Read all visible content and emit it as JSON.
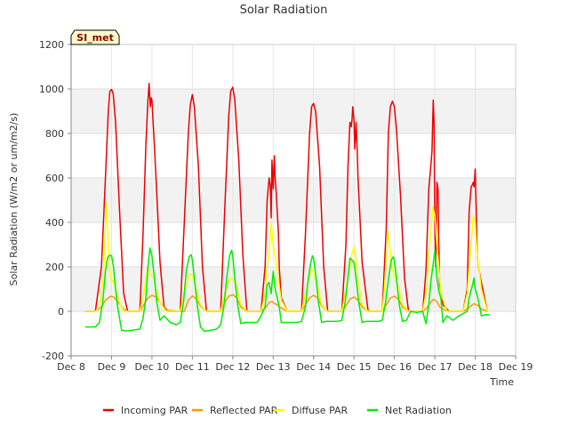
{
  "chart_data": {
    "type": "line",
    "title": "Solar Radiation",
    "xlabel": "Time",
    "ylabel": "Solar Radiation (W/m2 or um/m2/s)",
    "badge": "SI_met",
    "xlim": [
      8.0,
      19.0
    ],
    "ylim": [
      -200,
      1200
    ],
    "x_ticks": [
      8,
      9,
      10,
      11,
      12,
      13,
      14,
      15,
      16,
      17,
      18,
      19
    ],
    "x_tick_labels": [
      "Dec 8",
      "Dec 9",
      "Dec 10",
      "Dec 11",
      "Dec 12",
      "Dec 13",
      "Dec 14",
      "Dec 15",
      "Dec 16",
      "Dec 17",
      "Dec 18",
      "Dec 19"
    ],
    "y_ticks": [
      -200,
      0,
      200,
      400,
      600,
      800,
      1000,
      1200
    ],
    "y_tick_labels": [
      "-200",
      "0",
      "200",
      "400",
      "600",
      "800",
      "1000",
      "1200"
    ],
    "grid": true,
    "legend_position": "bottom",
    "series": [
      {
        "name": "Incoming PAR",
        "color": "#ee0000",
        "x": [
          8.35,
          8.6,
          8.75,
          8.85,
          8.92,
          8.96,
          9.0,
          9.04,
          9.1,
          9.2,
          9.3,
          9.4,
          9.7,
          9.78,
          9.85,
          9.9,
          9.93,
          9.96,
          9.98,
          10.0,
          10.02,
          10.05,
          10.1,
          10.2,
          10.3,
          10.4,
          10.7,
          10.8,
          10.9,
          10.95,
          11.0,
          11.05,
          11.15,
          11.25,
          11.35,
          11.7,
          11.8,
          11.9,
          11.95,
          12.0,
          12.05,
          12.15,
          12.25,
          12.35,
          12.7,
          12.8,
          12.85,
          12.9,
          12.93,
          12.95,
          12.97,
          13.0,
          13.03,
          13.05,
          13.08,
          13.1,
          13.13,
          13.15,
          13.2,
          13.35,
          13.7,
          13.8,
          13.9,
          13.95,
          14.0,
          14.05,
          14.15,
          14.25,
          14.35,
          14.7,
          14.8,
          14.85,
          14.9,
          14.93,
          14.95,
          14.97,
          15.0,
          15.02,
          15.05,
          15.08,
          15.1,
          15.2,
          15.35,
          15.7,
          15.8,
          15.85,
          15.9,
          15.95,
          16.0,
          16.05,
          16.15,
          16.25,
          16.35,
          16.7,
          16.78,
          16.85,
          16.9,
          16.93,
          16.96,
          16.98,
          17.0,
          17.02,
          17.05,
          17.08,
          17.1,
          17.12,
          17.2,
          17.35,
          17.7,
          17.8,
          17.85,
          17.9,
          17.93,
          17.95,
          17.97,
          18.0,
          18.02,
          18.05,
          18.08,
          18.1,
          18.15,
          18.3
        ],
        "y": [
          0,
          0,
          200,
          600,
          900,
          990,
          998,
          980,
          850,
          450,
          80,
          0,
          0,
          350,
          750,
          950,
          1025,
          920,
          960,
          950,
          880,
          780,
          600,
          220,
          20,
          0,
          0,
          400,
          800,
          930,
          975,
          920,
          650,
          200,
          0,
          0,
          450,
          880,
          990,
          1008,
          950,
          680,
          250,
          0,
          0,
          200,
          500,
          600,
          560,
          420,
          680,
          550,
          700,
          600,
          520,
          450,
          350,
          200,
          60,
          0,
          0,
          350,
          800,
          920,
          935,
          900,
          650,
          200,
          0,
          0,
          300,
          650,
          850,
          830,
          860,
          920,
          860,
          730,
          850,
          720,
          600,
          220,
          0,
          0,
          380,
          800,
          920,
          945,
          920,
          820,
          520,
          150,
          0,
          0,
          180,
          550,
          650,
          720,
          950,
          850,
          380,
          200,
          580,
          550,
          300,
          120,
          30,
          0,
          0,
          100,
          450,
          560,
          570,
          580,
          560,
          640,
          480,
          250,
          200,
          180,
          130,
          0
        ]
      },
      {
        "name": "Reflected PAR",
        "color": "#ff9900",
        "x": [
          8.35,
          8.6,
          8.75,
          8.85,
          8.95,
          9.0,
          9.05,
          9.15,
          9.3,
          9.4,
          9.7,
          9.8,
          9.9,
          10.0,
          10.1,
          10.2,
          10.35,
          10.7,
          10.8,
          10.9,
          11.0,
          11.1,
          11.2,
          11.35,
          11.7,
          11.8,
          11.9,
          12.0,
          12.1,
          12.2,
          12.35,
          12.7,
          12.8,
          12.9,
          12.97,
          13.03,
          13.1,
          13.2,
          13.35,
          13.7,
          13.8,
          13.9,
          14.0,
          14.1,
          14.2,
          14.35,
          14.7,
          14.8,
          14.9,
          15.0,
          15.1,
          15.2,
          15.35,
          15.7,
          15.8,
          15.9,
          16.0,
          16.1,
          16.2,
          16.35,
          16.7,
          16.8,
          16.9,
          16.96,
          17.0,
          17.05,
          17.12,
          17.3,
          17.7,
          17.8,
          17.9,
          17.97,
          18.02,
          18.08,
          18.15,
          18.3
        ],
        "y": [
          0,
          0,
          20,
          50,
          65,
          68,
          65,
          45,
          10,
          0,
          0,
          30,
          60,
          72,
          65,
          40,
          5,
          0,
          0,
          50,
          70,
          55,
          25,
          0,
          0,
          40,
          68,
          75,
          60,
          20,
          0,
          0,
          15,
          40,
          45,
          35,
          30,
          15,
          0,
          0,
          30,
          60,
          72,
          60,
          25,
          0,
          0,
          25,
          55,
          65,
          50,
          20,
          0,
          0,
          30,
          60,
          68,
          55,
          20,
          0,
          0,
          15,
          40,
          55,
          50,
          45,
          20,
          0,
          0,
          10,
          25,
          35,
          30,
          25,
          10,
          0
        ]
      },
      {
        "name": "Diffuse PAR",
        "color": "#ffff00",
        "x": [
          8.35,
          8.6,
          8.7,
          8.8,
          8.85,
          8.88,
          8.92,
          8.96,
          9.0,
          9.05,
          9.1,
          9.2,
          9.3,
          9.7,
          9.8,
          9.85,
          9.9,
          9.95,
          10.0,
          10.05,
          10.1,
          10.2,
          10.35,
          10.7,
          10.8,
          10.9,
          10.95,
          11.0,
          11.1,
          11.2,
          11.35,
          11.7,
          11.8,
          11.9,
          11.95,
          12.0,
          12.1,
          12.2,
          12.35,
          12.7,
          12.8,
          12.85,
          12.9,
          12.95,
          13.0,
          13.05,
          13.1,
          13.2,
          13.35,
          13.7,
          13.8,
          13.9,
          13.95,
          14.0,
          14.1,
          14.2,
          14.35,
          14.7,
          14.8,
          14.9,
          14.95,
          15.0,
          15.05,
          15.1,
          15.2,
          15.35,
          15.7,
          15.75,
          15.8,
          15.85,
          15.9,
          15.95,
          16.0,
          16.1,
          16.2,
          16.35,
          16.7,
          16.8,
          16.85,
          16.9,
          16.95,
          17.0,
          17.05,
          17.1,
          17.15,
          17.3,
          17.7,
          17.8,
          17.85,
          17.9,
          17.95,
          18.0,
          18.05,
          18.1,
          18.15,
          18.3
        ],
        "y": [
          0,
          0,
          20,
          150,
          380,
          490,
          300,
          180,
          130,
          140,
          100,
          40,
          0,
          0,
          80,
          150,
          200,
          170,
          160,
          150,
          100,
          40,
          0,
          0,
          80,
          150,
          170,
          160,
          100,
          30,
          0,
          0,
          80,
          140,
          150,
          145,
          110,
          30,
          0,
          0,
          80,
          200,
          260,
          400,
          300,
          250,
          180,
          50,
          0,
          0,
          80,
          160,
          190,
          175,
          110,
          30,
          0,
          0,
          100,
          200,
          260,
          290,
          240,
          140,
          30,
          0,
          0,
          100,
          240,
          360,
          260,
          190,
          160,
          110,
          30,
          0,
          0,
          100,
          250,
          350,
          470,
          430,
          300,
          200,
          80,
          0,
          0,
          80,
          200,
          300,
          430,
          400,
          250,
          180,
          100,
          0
        ]
      },
      {
        "name": "Net Radiation",
        "color": "#00ee00",
        "x": [
          8.35,
          8.6,
          8.7,
          8.78,
          8.85,
          8.9,
          8.95,
          9.0,
          9.05,
          9.1,
          9.15,
          9.25,
          9.35,
          9.5,
          9.7,
          9.78,
          9.85,
          9.9,
          9.95,
          10.0,
          10.05,
          10.12,
          10.2,
          10.3,
          10.45,
          10.6,
          10.7,
          10.78,
          10.85,
          10.92,
          10.97,
          11.0,
          11.05,
          11.12,
          11.2,
          11.3,
          11.45,
          11.6,
          11.7,
          11.78,
          11.85,
          11.92,
          11.97,
          12.0,
          12.05,
          12.12,
          12.2,
          12.3,
          12.45,
          12.6,
          12.7,
          12.8,
          12.85,
          12.9,
          12.95,
          13.0,
          13.05,
          13.1,
          13.15,
          13.2,
          13.3,
          13.45,
          13.6,
          13.7,
          13.8,
          13.85,
          13.92,
          13.97,
          14.0,
          14.05,
          14.12,
          14.2,
          14.3,
          14.45,
          14.6,
          14.7,
          14.78,
          14.85,
          14.9,
          14.95,
          15.0,
          15.05,
          15.12,
          15.2,
          15.3,
          15.45,
          15.6,
          15.7,
          15.78,
          15.85,
          15.92,
          15.97,
          16.0,
          16.05,
          16.12,
          16.2,
          16.3,
          16.4,
          16.55,
          16.7,
          16.78,
          16.85,
          16.9,
          16.95,
          17.0,
          17.05,
          17.1,
          17.15,
          17.2,
          17.3,
          17.45,
          17.6,
          17.7,
          17.8,
          17.85,
          17.92,
          17.97,
          18.0,
          18.05,
          18.1,
          18.15,
          18.25,
          18.35
        ],
        "y": [
          -70,
          -70,
          -50,
          40,
          180,
          240,
          252,
          250,
          200,
          100,
          20,
          -85,
          -88,
          -85,
          -80,
          -30,
          60,
          200,
          285,
          250,
          170,
          40,
          -40,
          -20,
          -50,
          -60,
          -50,
          40,
          180,
          245,
          255,
          230,
          150,
          30,
          -70,
          -90,
          -85,
          -80,
          -60,
          20,
          150,
          250,
          275,
          250,
          150,
          30,
          -55,
          -50,
          -50,
          -50,
          -20,
          20,
          120,
          130,
          80,
          180,
          100,
          60,
          20,
          -50,
          -50,
          -50,
          -50,
          -45,
          20,
          120,
          210,
          250,
          240,
          170,
          40,
          -50,
          -45,
          -45,
          -45,
          -40,
          40,
          150,
          240,
          230,
          220,
          150,
          40,
          -50,
          -45,
          -45,
          -45,
          -40,
          40,
          140,
          230,
          245,
          230,
          150,
          30,
          -45,
          -40,
          0,
          -5,
          0,
          -55,
          30,
          130,
          200,
          275,
          150,
          90,
          60,
          -50,
          -20,
          -40,
          -20,
          -10,
          0,
          60,
          110,
          150,
          100,
          70,
          30,
          -20,
          -15,
          -15
        ]
      }
    ]
  }
}
